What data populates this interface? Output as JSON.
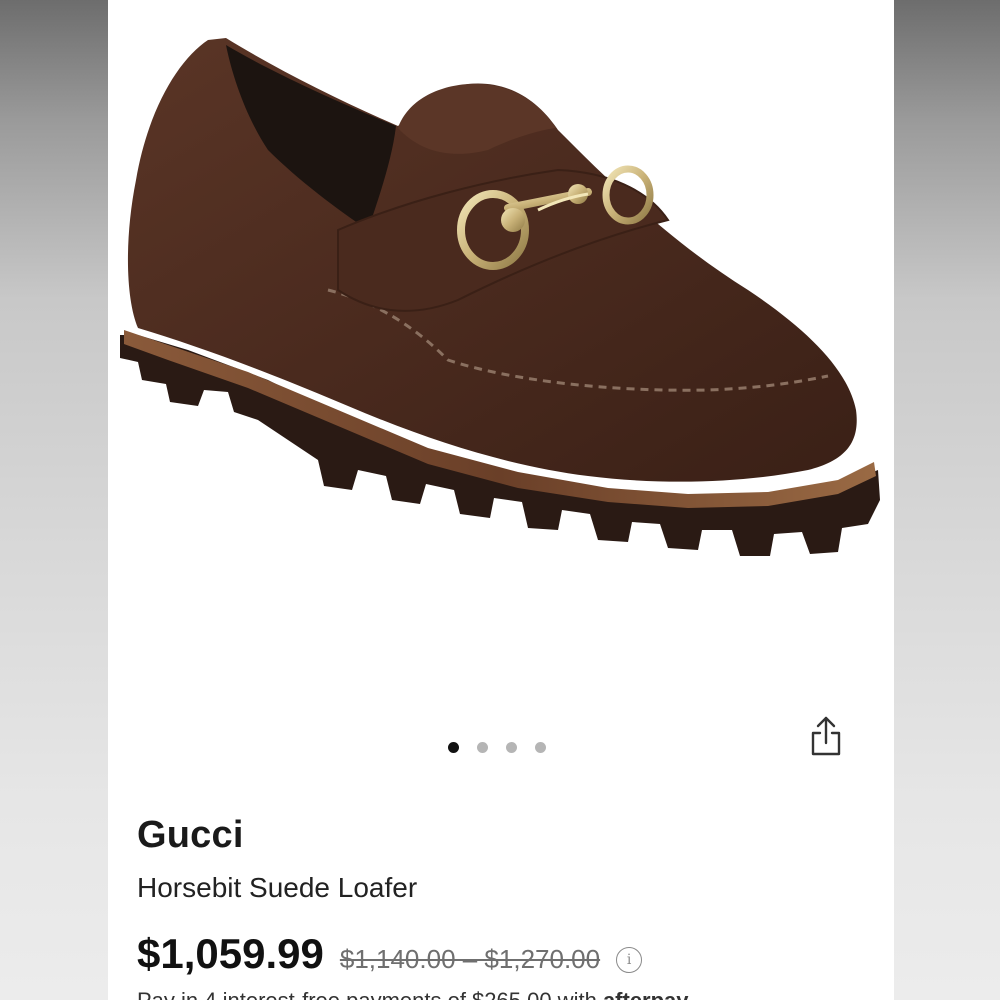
{
  "product": {
    "brand": "Gucci",
    "name": "Horsebit Suede Loafer",
    "sale_price": "$1,059.99",
    "list_price": "$1,140.00 – $1,270.00",
    "info_icon": "info-icon"
  },
  "carousel": {
    "total": 4,
    "active_index": 0
  },
  "share": {
    "icon": "share-icon"
  },
  "installment": {
    "text": "Pay in 4 interest-free payments of $265.00 with",
    "provider": "afterpay"
  },
  "colors": {
    "suede": "#4a2a1e",
    "sole": "#2a1a14",
    "hardware": "#d8c48a",
    "active_dot": "#111111",
    "inactive_dot": "#b5b5b5"
  }
}
